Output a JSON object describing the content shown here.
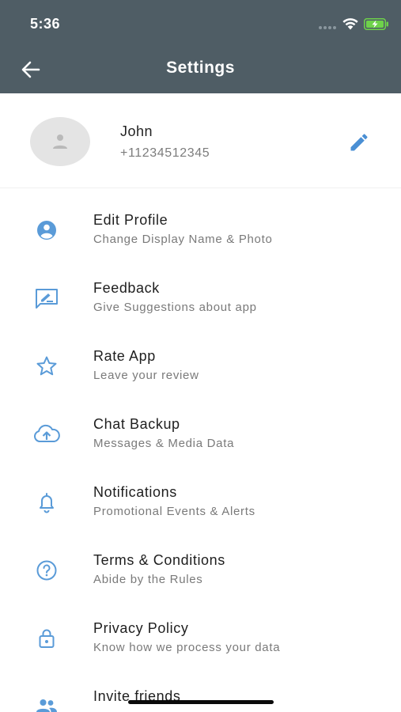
{
  "status_bar": {
    "time": "5:36",
    "icons": [
      "signal-dots-icon",
      "wifi-icon",
      "battery-charging-icon"
    ]
  },
  "header": {
    "title": "Settings",
    "back_icon": "arrow-left-icon"
  },
  "profile": {
    "name": "John",
    "phone": "+11234512345",
    "avatar_icon": "person-placeholder-icon",
    "edit_icon": "pencil-icon"
  },
  "menu": {
    "items": [
      {
        "title": "Edit Profile",
        "subtitle": "Change Display Name & Photo",
        "icon": "account-circle-icon"
      },
      {
        "title": "Feedback",
        "subtitle": "Give Suggestions about app",
        "icon": "feedback-icon"
      },
      {
        "title": "Rate App",
        "subtitle": "Leave your review",
        "icon": "star-icon"
      },
      {
        "title": "Chat Backup",
        "subtitle": "Messages & Media Data",
        "icon": "cloud-upload-icon"
      },
      {
        "title": "Notifications",
        "subtitle": "Promotional Events & Alerts",
        "icon": "bell-icon"
      },
      {
        "title": "Terms & Conditions",
        "subtitle": "Abide by the Rules",
        "icon": "help-circle-icon"
      },
      {
        "title": "Privacy Policy",
        "subtitle": "Know how we process your data",
        "icon": "lock-icon"
      },
      {
        "title": "Invite friends",
        "subtitle": "",
        "icon": "people-icon"
      }
    ]
  },
  "colors": {
    "header_bg": "#4f5d65",
    "accent_icon": "#5a9bd8",
    "battery": "#6ed24a"
  }
}
